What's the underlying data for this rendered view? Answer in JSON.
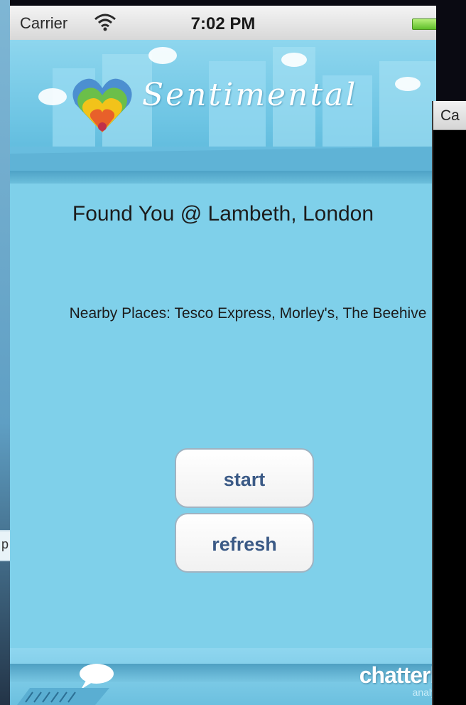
{
  "status_bar": {
    "carrier": "Carrier",
    "time": "7:02 PM"
  },
  "app": {
    "name": "Sentimental"
  },
  "location": {
    "text": "Found You @ Lambeth, London"
  },
  "nearby": {
    "text": "Nearby Places: Tesco Express, Morley's, The Beehive"
  },
  "buttons": {
    "start_label": "start",
    "refresh_label": "refresh"
  },
  "footer": {
    "brand": "chatterb",
    "brand_sub": "analy"
  },
  "overlay_window": {
    "carrier_partial": "Ca"
  },
  "background_window": {
    "partial_text": "p"
  },
  "colors": {
    "screen_background": "#7fd0ea",
    "button_text": "#3b5a86",
    "battery": "#5fbf2a"
  },
  "icons": [
    "wifi-icon",
    "battery-icon",
    "heart-logo-icon",
    "speech-bubble-icon"
  ]
}
